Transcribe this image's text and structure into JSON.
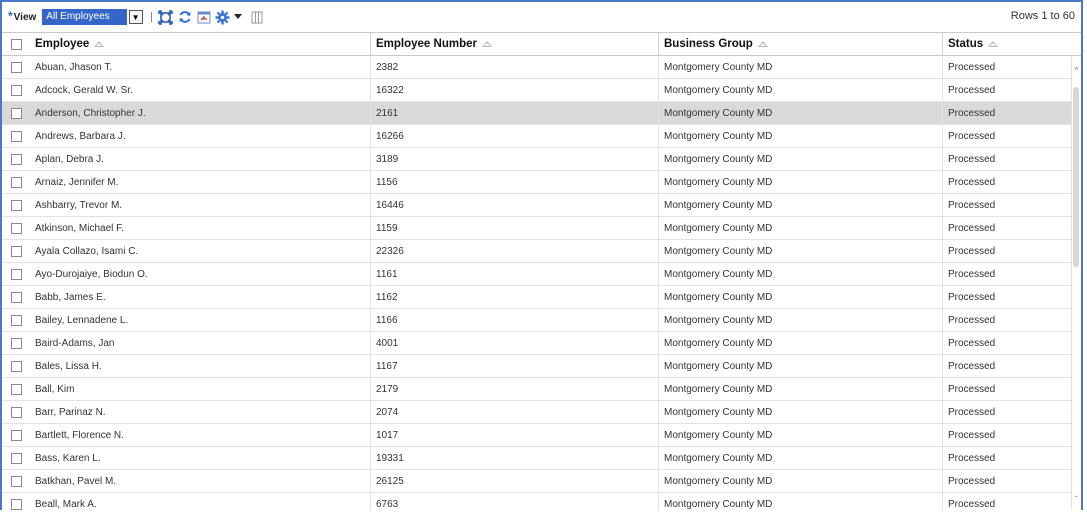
{
  "toolbar": {
    "view_required_mark": "*",
    "view_label": "View",
    "view_selected": "All Employees",
    "rows_info": "Rows 1 to 60"
  },
  "icons": {
    "view_arrow": "chevron-down-icon",
    "detach": "detach-icon",
    "refresh": "refresh-icon",
    "reorder": "reorder-icon",
    "settings": "gear-icon",
    "settings_menu": "caret-down-icon",
    "freeze": "freeze-columns-icon"
  },
  "colors": {
    "accent": "#3465c9",
    "frame": "#4a79c7",
    "selected_row": "#d9d9d9"
  },
  "table": {
    "columns": [
      "Employee",
      "Employee Number",
      "Business Group",
      "Status"
    ],
    "selected_row_index": 2,
    "rows": [
      {
        "employee": "Abuan, Jhason T.",
        "number": "2382",
        "group": "Montgomery County MD",
        "status": "Processed"
      },
      {
        "employee": "Adcock, Gerald W. Sr.",
        "number": "16322",
        "group": "Montgomery County MD",
        "status": "Processed"
      },
      {
        "employee": "Anderson, Christopher J.",
        "number": "2161",
        "group": "Montgomery County MD",
        "status": "Processed"
      },
      {
        "employee": "Andrews, Barbara J.",
        "number": "16266",
        "group": "Montgomery County MD",
        "status": "Processed"
      },
      {
        "employee": "Aplan, Debra J.",
        "number": "3189",
        "group": "Montgomery County MD",
        "status": "Processed"
      },
      {
        "employee": "Arnaiz, Jennifer M.",
        "number": "1156",
        "group": "Montgomery County MD",
        "status": "Processed"
      },
      {
        "employee": "Ashbarry, Trevor M.",
        "number": "16446",
        "group": "Montgomery County MD",
        "status": "Processed"
      },
      {
        "employee": "Atkinson, Michael F.",
        "number": "1159",
        "group": "Montgomery County MD",
        "status": "Processed"
      },
      {
        "employee": "Ayala Collazo, Isami C.",
        "number": "22326",
        "group": "Montgomery County MD",
        "status": "Processed"
      },
      {
        "employee": "Ayo-Durojaiye, Biodun O.",
        "number": "1161",
        "group": "Montgomery County MD",
        "status": "Processed"
      },
      {
        "employee": "Babb, James E.",
        "number": "1162",
        "group": "Montgomery County MD",
        "status": "Processed"
      },
      {
        "employee": "Bailey, Lennadene L.",
        "number": "1166",
        "group": "Montgomery County MD",
        "status": "Processed"
      },
      {
        "employee": "Baird-Adams, Jan",
        "number": "4001",
        "group": "Montgomery County MD",
        "status": "Processed"
      },
      {
        "employee": "Bales, Lissa H.",
        "number": "1167",
        "group": "Montgomery County MD",
        "status": "Processed"
      },
      {
        "employee": "Ball, Kim",
        "number": "2179",
        "group": "Montgomery County MD",
        "status": "Processed"
      },
      {
        "employee": "Barr, Parinaz N.",
        "number": "2074",
        "group": "Montgomery County MD",
        "status": "Processed"
      },
      {
        "employee": "Bartlett, Florence N.",
        "number": "1017",
        "group": "Montgomery County MD",
        "status": "Processed"
      },
      {
        "employee": "Bass, Karen L.",
        "number": "19331",
        "group": "Montgomery County MD",
        "status": "Processed"
      },
      {
        "employee": "Batkhan, Pavel M.",
        "number": "26125",
        "group": "Montgomery County MD",
        "status": "Processed"
      },
      {
        "employee": "Beall, Mark A.",
        "number": "6763",
        "group": "Montgomery County MD",
        "status": "Processed"
      }
    ]
  }
}
